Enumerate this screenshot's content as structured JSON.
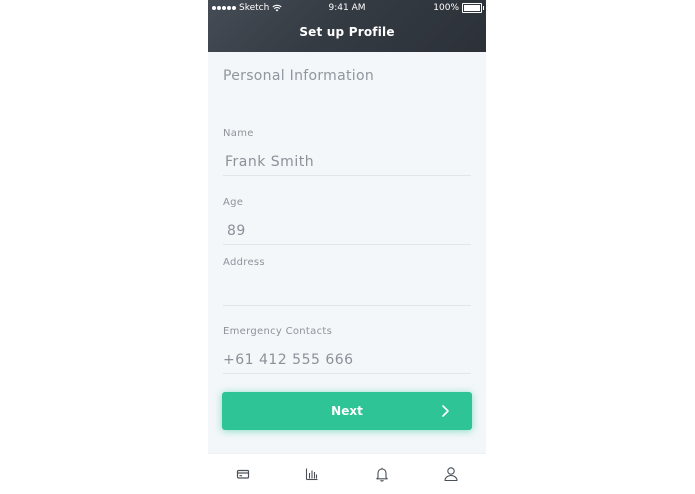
{
  "status_bar": {
    "carrier": "Sketch",
    "time": "9:41 AM",
    "battery": "100%"
  },
  "header": {
    "title": "Set up Profile"
  },
  "form": {
    "section_title": "Personal Information",
    "name_label": "Name",
    "name_value": "Frank Smith",
    "age_label": "Age",
    "age_value": "89",
    "address_label": "Address",
    "address_value": "",
    "emergency_label": "Emergency Contacts",
    "emergency_value": "+61 412 555 666"
  },
  "next_button": {
    "label": "Next"
  },
  "tab_bar": {
    "items": [
      {
        "icon": "card-icon"
      },
      {
        "icon": "bar-chart-icon"
      },
      {
        "icon": "bell-icon"
      },
      {
        "icon": "user-icon"
      }
    ]
  },
  "colors": {
    "header_bg": "#353b43",
    "accent": "#2ec495",
    "page_bg": "#f3f7fa",
    "text_muted": "#8b9199"
  }
}
